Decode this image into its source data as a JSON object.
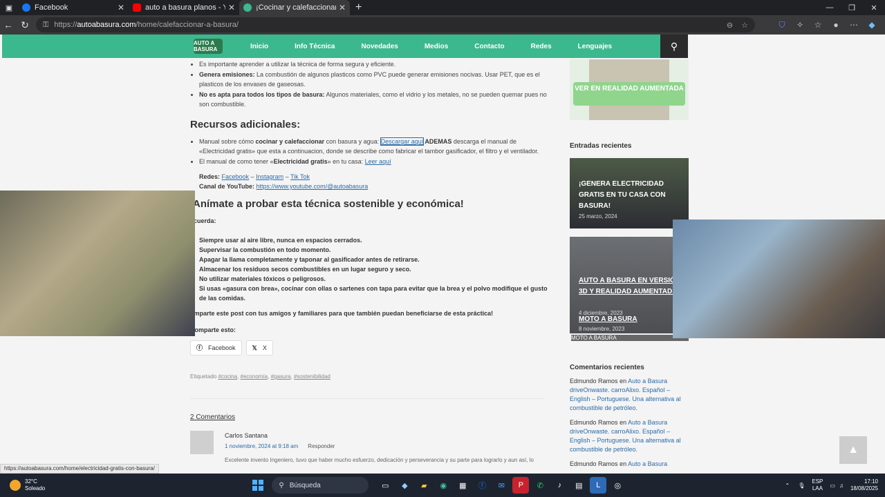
{
  "browser": {
    "tabs": [
      {
        "title": "Facebook",
        "color": "#1877f2"
      },
      {
        "title": "auto a basura planos - YouTube",
        "color": "#ff0000"
      },
      {
        "title": "¡Cocinar y calefaccionar con basu",
        "color": "#3bb88e"
      }
    ],
    "url_host": "autoabasura.com",
    "url_prefix": "https://",
    "url_path": "/home/calefaccionar-a-basura/",
    "status_url": "https://autoabasura.com/home/electricidad-gratis-con-basura/"
  },
  "site": {
    "logo_text": "AUTO A BASURA",
    "nav": [
      "Inicio",
      "Info Técnica",
      "Novedades",
      "Medios",
      "Contacto",
      "Redes",
      "Lenguajes"
    ],
    "accent": "#3bb88e"
  },
  "article": {
    "bullets_top": [
      {
        "bold": "",
        "text": "Es importante aprender a utilizar la técnica de forma segura y eficiente."
      },
      {
        "bold": "Genera emisiones:",
        "text": " La combustión de algunos plasticos como PVC puede generar emisiones nocivas. Usar PET, que es el plasticos de los envases de gaseosas."
      },
      {
        "bold": "No es apta para todos los tipos de basura:",
        "text": " Algunos materiales, como el vidrio y los metales, no se pueden quemar pues no son combustible."
      }
    ],
    "recursos_title": "Recursos adicionales:",
    "recurso1_a": "Manual sobre cómo ",
    "recurso1_b": "cocinar y calefaccionar",
    "recurso1_c": " con basura y agua: ",
    "recurso1_link": "Descargar aquí",
    "recurso1_d": " ADEMAS",
    "recurso1_e": " descarga el manual de «Electricidad gratis» que esta a continuacion, donde se describe como fabricar el tambor gasificador, el filtro y el ventilador.",
    "recurso2_a": "El manual de como tener «",
    "recurso2_b": "Electricidad gratis",
    "recurso2_c": "» en tu casa: ",
    "recurso2_link": "Leer aquí",
    "redes_label": "Redes:",
    "redes_links": [
      "Facebook",
      "Instagram",
      "Tik Tok"
    ],
    "youtube_label": "Canal de YouTube:",
    "youtube_link": "https://www.youtube.com/@autoabasura",
    "animate_title": "Anímate a probar esta técnica sostenible y económica!",
    "recuerda": "ecuerda:",
    "recuerda_items": [
      "Siempre usar al aire libre, nunca en espacios cerrados.",
      "Supervisar la combustión en todo momento.",
      "Apagar la llama completamente y taponar al gasificador antes de retirarse.",
      "Almacenar los residuos secos combustibles en un lugar seguro y seco.",
      "No utilizar materiales tóxicos o peligrosos.",
      "Si usas «gasura con brea», cocinar con ollas o sartenes con tapa para evitar que la brea y el polvo modifique el gusto de las comidas."
    ],
    "share_cta": "omparte este post con tus amigos y familiares para que también puedan beneficiarse de esta práctica!",
    "share_label": "Comparte esto:",
    "share_buttons": [
      "Facebook",
      "X"
    ],
    "tags_label": "Etiquetado",
    "tags": [
      "#cocina",
      "#economía",
      "#gasura",
      "#sostenibilidad"
    ],
    "comments_title": "2 Comentarios",
    "comment": {
      "author": "Carlos Santana",
      "date": "1 noviembre, 2024 at 9:18 am",
      "reply": "Responder",
      "text": "Excelente invento Ingeniero, tuvo que haber mucho esfuerzo, dedicación y perseverancia y su parte para lograrlo y aun así, lo"
    }
  },
  "sidebar": {
    "ar_button": "VER EN REALIDAD AUMENTADA",
    "recent_title": "Entradas recientes",
    "posts": [
      {
        "title": "¡GENERA ELECTRICIDAD GRATIS EN TU CASA CON BASURA!",
        "date": "25 marzo, 2024"
      },
      {
        "title": "AUTO A BASURA EN VERSIÓN 3D Y REALIDAD AUMENTADA",
        "date": "4 diciembre, 2023"
      },
      {
        "title": "MOTO A BASURA",
        "date": "8 noviembre, 2023"
      }
    ],
    "broken_img_alt": "MOTO A BASURA",
    "comments_title": "Comentarios recientes",
    "recent_comments": [
      {
        "author": "Edmundo Ramos",
        "on": "en",
        "link": "Auto a Basura driveOnwaste. carroAlixo. Español – English – Portuguese. Una alternativa al combustible de petróleo."
      },
      {
        "author": "Edmundo Ramos",
        "on": "en",
        "link": "Auto a Basura driveOnwaste. carroAlixo. Español – English – Portuguese. Una alternativa al combustible de petróleo."
      },
      {
        "author": "Edmundo Ramos",
        "on": "en",
        "link": "Auto a Basura"
      }
    ]
  },
  "taskbar": {
    "temp": "32°C",
    "weather": "Soleado",
    "search_placeholder": "Búsqueda",
    "lang_top": "ESP",
    "lang_bottom": "LAA",
    "time": "17:10",
    "date": "18/08/2025"
  }
}
